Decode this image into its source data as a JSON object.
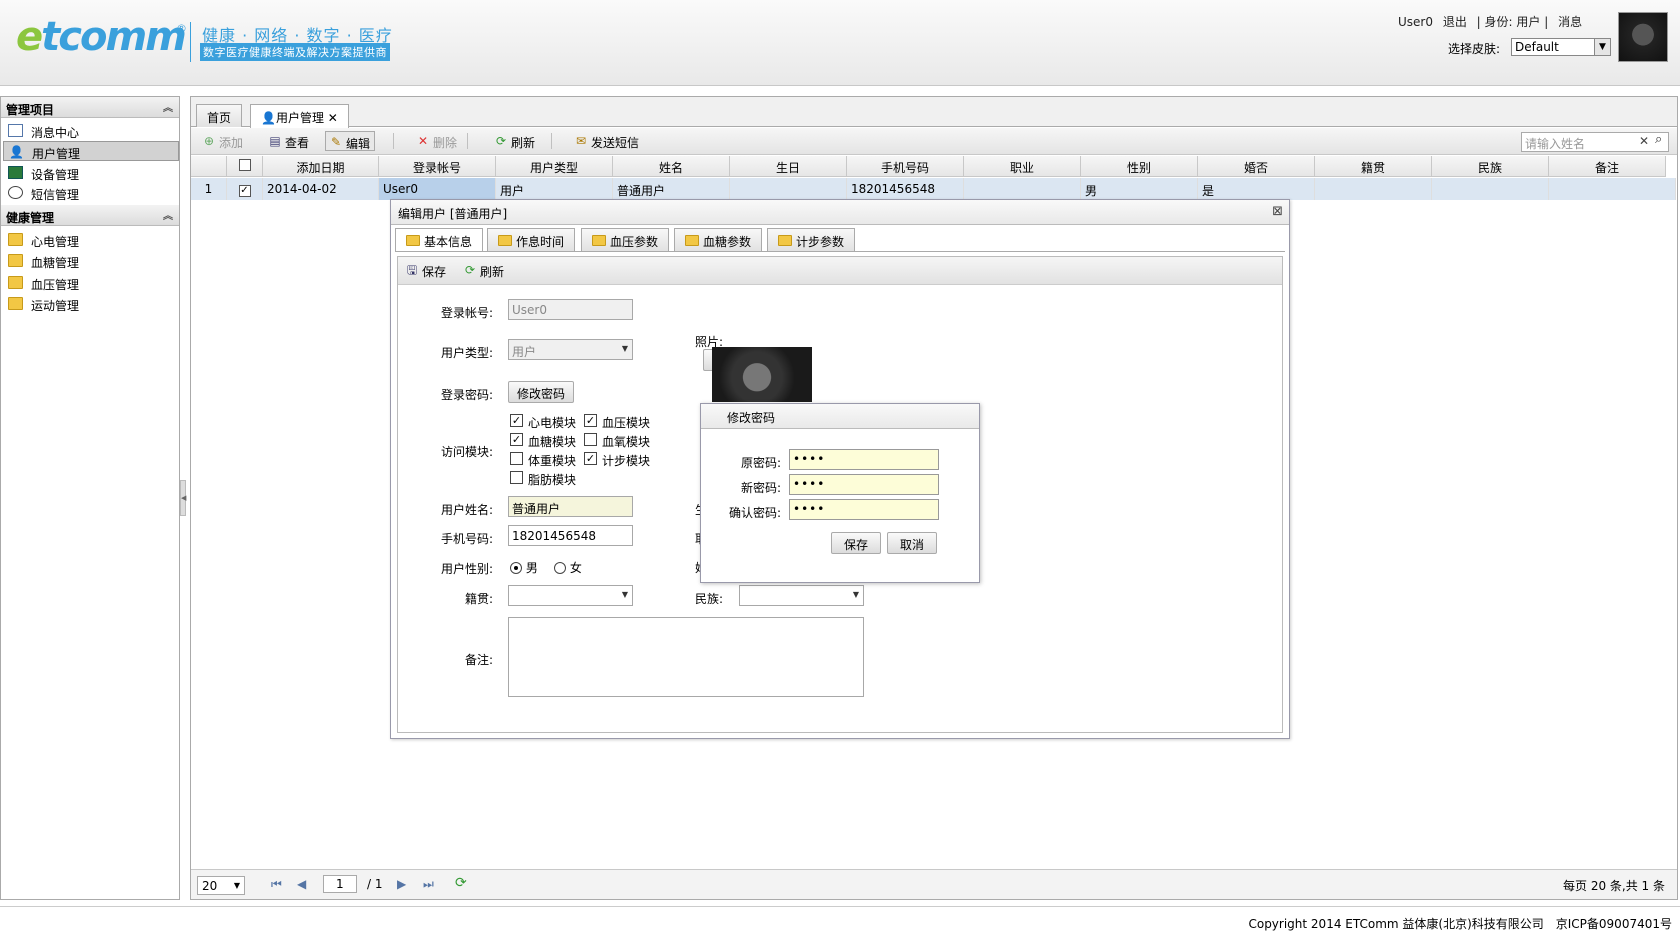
{
  "header": {
    "logo": "etcomm",
    "logo_reg": "®",
    "slogan": "健康 · 网络 · 数字 · 医疗",
    "subslogan": "数字医疗健康终端及解决方案提供商",
    "user": "User0",
    "logout": "退出",
    "identity": "| 身份: 用户 |",
    "messages": "消息",
    "skin_label": "选择皮肤:",
    "skin_value": "Default"
  },
  "sidebar": {
    "section1": "管理项目",
    "items1": [
      {
        "label": "消息中心",
        "icon": "mail-icon"
      },
      {
        "label": "用户管理",
        "icon": "user-icon"
      },
      {
        "label": "设备管理",
        "icon": "device-icon"
      },
      {
        "label": "短信管理",
        "icon": "sms-icon"
      }
    ],
    "section2": "健康管理",
    "items2": [
      {
        "label": "心电管理"
      },
      {
        "label": "血糖管理"
      },
      {
        "label": "血压管理"
      },
      {
        "label": "运动管理"
      }
    ]
  },
  "tabs": [
    "首页",
    "用户管理"
  ],
  "toolbar": {
    "add": "添加",
    "view": "查看",
    "edit": "编辑",
    "delete": "删除",
    "refresh": "刷新",
    "sms": "发送短信",
    "search_placeholder": "请输入姓名"
  },
  "grid": {
    "headers": [
      "添加日期",
      "登录帐号",
      "用户类型",
      "姓名",
      "生日",
      "手机号码",
      "职业",
      "性别",
      "婚否",
      "籍贯",
      "民族",
      "备注"
    ],
    "rows": [
      {
        "no": "1",
        "date": "2014-04-02",
        "account": "User0",
        "type": "用户",
        "name": "普通用户",
        "birthday": "",
        "phone": "18201456548",
        "job": "",
        "gender": "男",
        "married": "是",
        "native": "",
        "nation": "",
        "remark": ""
      }
    ]
  },
  "pager": {
    "size": "20",
    "page": "1",
    "total_pages": "/ 1",
    "summary": "每页 20 条,共 1 条"
  },
  "footer": "Copyright 2014 ETComm 益体康(北京)科技有限公司　京ICP备09007401号",
  "edit": {
    "title": "编辑用户 [普通用户]",
    "tabs": [
      "基本信息",
      "作息时间",
      "血压参数",
      "血糖参数",
      "计步参数"
    ],
    "save": "保存",
    "refresh": "刷新",
    "account_label": "登录帐号:",
    "account_value": "User0",
    "type_label": "用户类型:",
    "type_value": "用户",
    "photo_label": "照片:",
    "password_label": "登录密码:",
    "password_btn": "修改密码",
    "modules_label": "访问模块:",
    "modules": [
      {
        "label": "心电模块",
        "checked": true
      },
      {
        "label": "血压模块",
        "checked": true
      },
      {
        "label": "血糖模块",
        "checked": true
      },
      {
        "label": "血氧模块",
        "checked": false
      },
      {
        "label": "体重模块",
        "checked": false
      },
      {
        "label": "计步模块",
        "checked": true
      },
      {
        "label": "脂肪模块",
        "checked": false
      }
    ],
    "name_label": "用户姓名:",
    "name_value": "普通用户",
    "phone_label": "手机号码:",
    "phone_value": "18201456548",
    "gender_label": "用户性别:",
    "male": "男",
    "female": "女",
    "native_label": "籍贯:",
    "nation_label": "民族:",
    "remark_label": "备注:",
    "right_cut1": "生",
    "right_cut2": "耶",
    "right_cut3": "婚"
  },
  "pwd_dialog": {
    "title": "修改密码",
    "old_label": "原密码:",
    "new_label": "新密码:",
    "confirm_label": "确认密码:",
    "old_value": "••••",
    "new_value": "••••",
    "confirm_value": "••••",
    "save": "保存",
    "cancel": "取消"
  }
}
